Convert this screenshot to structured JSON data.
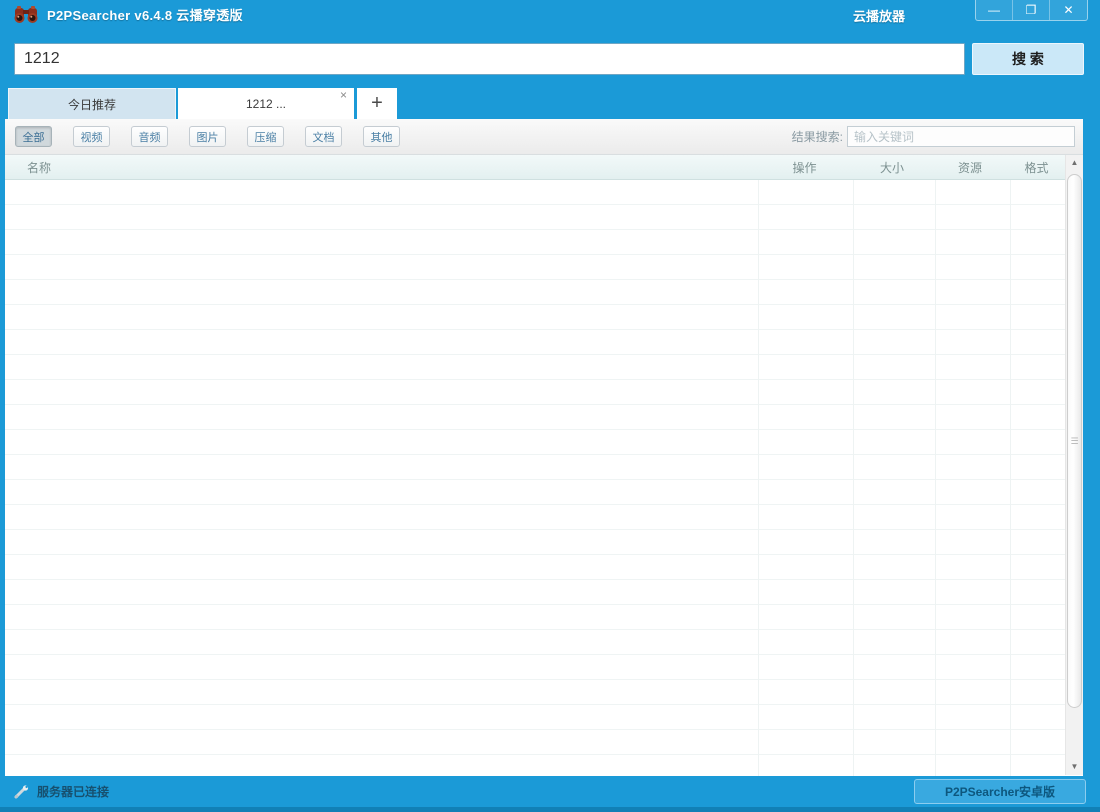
{
  "window": {
    "title": "P2PSearcher v6.4.8 云播穿透版",
    "right_label": "云播放器",
    "controls": {
      "minimize": "—",
      "maximize": "❐",
      "close": "✕"
    }
  },
  "search": {
    "value": "1212",
    "button_label": "搜 索"
  },
  "tabs": {
    "items": [
      {
        "label": "今日推荐",
        "active": false
      },
      {
        "label": "1212 ...",
        "active": true
      }
    ],
    "close_glyph": "×",
    "new_tab_label": "+"
  },
  "filters": {
    "buttons": [
      {
        "label": "全部",
        "active": true
      },
      {
        "label": "视频",
        "active": false
      },
      {
        "label": "音频",
        "active": false
      },
      {
        "label": "图片",
        "active": false
      },
      {
        "label": "压缩",
        "active": false
      },
      {
        "label": "文档",
        "active": false
      },
      {
        "label": "其他",
        "active": false
      }
    ],
    "result_search_label": "结果搜索:",
    "result_search_placeholder": "输入关键词"
  },
  "table": {
    "columns": [
      {
        "label": "名称"
      },
      {
        "label": "操作"
      },
      {
        "label": "大小"
      },
      {
        "label": "资源"
      },
      {
        "label": "格式"
      }
    ],
    "rows": []
  },
  "icons": {
    "app": "binoculars-icon",
    "status": "wrench-icon",
    "scroll_up": "▲",
    "scroll_down": "▼",
    "thumb_grip": "☰"
  },
  "statusbar": {
    "left_text": "服务器已连接",
    "right_label": "P2PSearcher安卓版"
  },
  "colors": {
    "accent_blue": "#1b9ad7",
    "bottom_edge_blue": "#1180b6",
    "search_button_bg": "#cbe8f8",
    "inactive_tab_bg": "#d2e4f0",
    "filter_text_blue": "#4a7fa5",
    "table_header_bg": "#e8f3f3",
    "status_text": "#17506f"
  }
}
